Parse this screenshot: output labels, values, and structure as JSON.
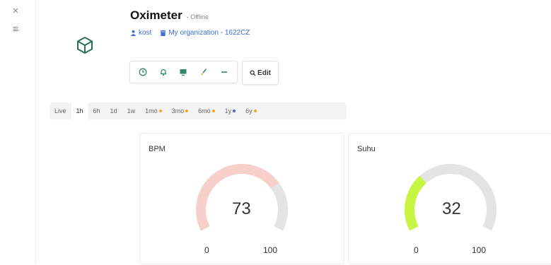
{
  "sidebar": {
    "close_glyph": "×",
    "menu_glyph": "≡"
  },
  "device": {
    "title": "Oximeter",
    "status": "- Offline",
    "owner": "kost",
    "organization": "My organization - 1622CZ",
    "icon": "cube-icon"
  },
  "toolbar": {
    "icons": [
      "clock-icon",
      "bell-icon",
      "dashboard-icon",
      "brush-icon",
      "more-icon"
    ],
    "edit_label": "Edit"
  },
  "time_range": {
    "items": [
      {
        "label": "Live",
        "dot": null
      },
      {
        "label": "1h",
        "dot": null,
        "active": true
      },
      {
        "label": "6h",
        "dot": null
      },
      {
        "label": "1d",
        "dot": null
      },
      {
        "label": "1w",
        "dot": null
      },
      {
        "label": "1mo",
        "dot": "#f5a623"
      },
      {
        "label": "3mo",
        "dot": "#f5a623"
      },
      {
        "label": "6mo",
        "dot": "#f5a623"
      },
      {
        "label": "1y",
        "dot": "#3b6fd8"
      },
      {
        "label": "6y",
        "dot": "#f5a623"
      }
    ]
  },
  "widgets": [
    {
      "label": "BPM",
      "value": "73",
      "value_num": 73,
      "min": "0",
      "max": "100",
      "min_num": 0,
      "max_num": 100,
      "color": "#f7cfcb",
      "track": "#e4e4e4"
    },
    {
      "label": "Suhu",
      "value": "32",
      "value_num": 32,
      "min": "0",
      "max": "100",
      "min_num": 0,
      "max_num": 100,
      "color": "#c6f542",
      "track": "#e4e4e4"
    }
  ]
}
